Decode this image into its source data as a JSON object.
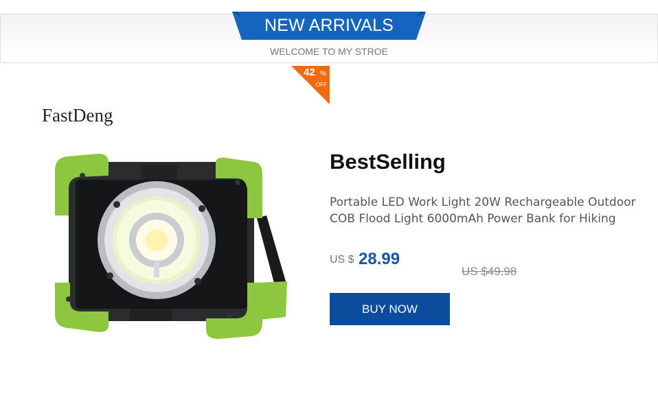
{
  "header": {
    "title": "NEW ARRIVALS",
    "subtitle": "WELCOME TO MY STROE",
    "banner_color": "#1565c0"
  },
  "badge": {
    "discount_value": "42",
    "percent_sign": "%",
    "off_label": "OFF",
    "badge_color": "#f26a0f"
  },
  "brand": "FastDeng",
  "product": {
    "heading": "BestSelling",
    "description": "Portable LED Work Light 20W Rechargeable Outdoor COB Flood Light 6000mAh Power Bank for Hiking",
    "currency": "US $",
    "price": "28.99",
    "original_price": "US $49.98",
    "buy_label": "BUY NOW",
    "accent_color": "#0b4d9c",
    "image_icon": "led-work-light-image"
  }
}
